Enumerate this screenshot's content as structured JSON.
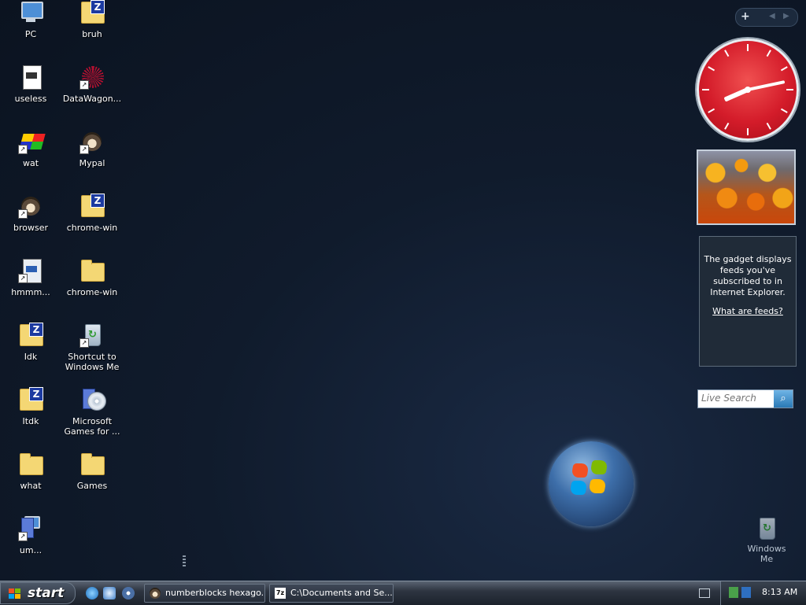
{
  "desktop": {
    "icons": [
      {
        "label": "PC",
        "icon": "computer-icon"
      },
      {
        "label": "bruh",
        "icon": "zip-folder-icon"
      },
      {
        "label": "useless",
        "icon": "document-icon"
      },
      {
        "label": "DataWagon...",
        "icon": "datawagon-icon"
      },
      {
        "label": "wat",
        "icon": "wat-icon"
      },
      {
        "label": "Mypal",
        "icon": "mypal-raccoon-icon"
      },
      {
        "label": "browser",
        "icon": "raccoon-browser-icon"
      },
      {
        "label": "chrome-win",
        "icon": "zip-folder-icon"
      },
      {
        "label": "hmmm...",
        "icon": "program-icon"
      },
      {
        "label": "chrome-win",
        "icon": "folder-icon"
      },
      {
        "label": "Idk",
        "icon": "zip-folder-icon"
      },
      {
        "label": "Shortcut to Windows Me",
        "icon": "recycle-bin-icon"
      },
      {
        "label": "Itdk",
        "icon": "zip-folder-icon"
      },
      {
        "label": "Microsoft Games for ...",
        "icon": "games-cd-icon"
      },
      {
        "label": "what",
        "icon": "folder-icon"
      },
      {
        "label": "Games",
        "icon": "folder-icon"
      },
      {
        "label": "um...",
        "icon": "installer-icon"
      }
    ],
    "recycle_bin_label": "Windows Me"
  },
  "gadgets": {
    "bar": {
      "add": "+",
      "prev": "◀",
      "next": "▶"
    },
    "clock": {
      "hour": 8,
      "minute": 13
    },
    "feeds": {
      "message": "The gadget displays feeds you've subscribed to in Internet Explorer.",
      "link": "What are feeds?"
    },
    "live_search": {
      "placeholder": "Live Search",
      "button_icon": "search-icon"
    }
  },
  "taskbar": {
    "start_label": "start",
    "tasks": [
      {
        "label": "numberblocks hexago...",
        "icon": "raccoon-browser-icon"
      },
      {
        "label": "C:\\Documents and Se...",
        "icon": "7zip-icon"
      }
    ],
    "time": "8:13 AM"
  },
  "colors": {
    "desktop": "#101b2c",
    "clock_face": "#d41c2a",
    "taskbar": "#2e3541"
  }
}
